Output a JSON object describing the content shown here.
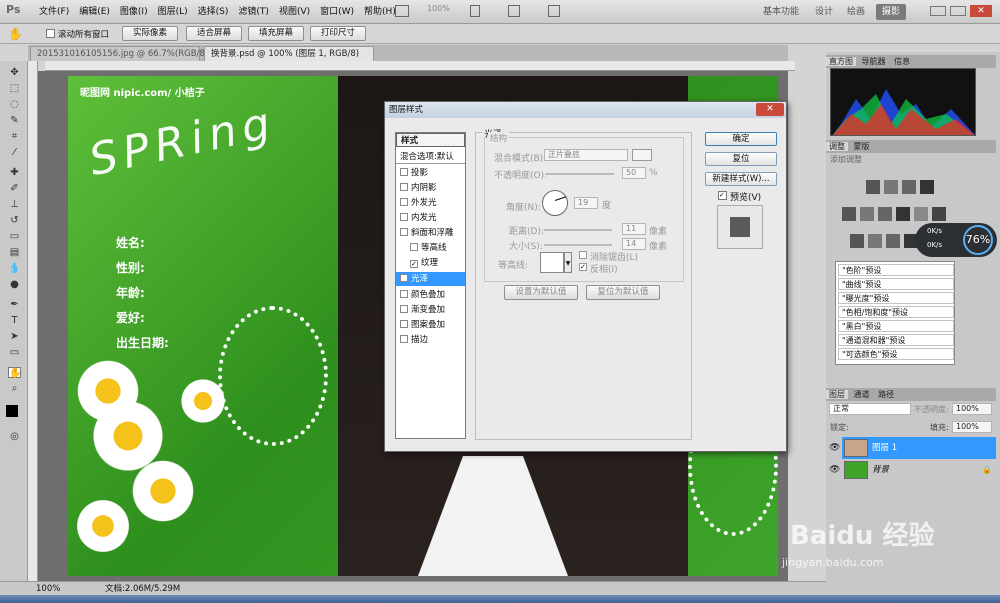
{
  "menubar": {
    "logo": "Ps",
    "items": [
      "文件(F)",
      "编辑(E)",
      "图像(I)",
      "图层(L)",
      "选择(S)",
      "滤镜(T)",
      "视图(V)",
      "窗口(W)",
      "帮助(H)"
    ],
    "zoom": "100%",
    "workspaces": [
      "基本功能",
      "设计",
      "绘画",
      "摄影"
    ],
    "active_workspace": "摄影"
  },
  "options": {
    "scroll_all": "滚动所有窗口",
    "buttons": [
      "实际像素",
      "适合屏幕",
      "填充屏幕",
      "打印尺寸"
    ]
  },
  "tabs": [
    {
      "label": "20153101610515​6.jpg @ 66.7%(RGB/8)"
    },
    {
      "label": "换背景.psd @ 100% (图层 1, RGB/8)"
    }
  ],
  "image": {
    "site": "昵图网 nipic.com/ 小桔子",
    "spring": "SPRing",
    "labels": [
      "姓名:",
      "性别:",
      "年龄:",
      "爱好:",
      "出生日期:"
    ]
  },
  "dialog": {
    "title": "图层样式",
    "styles_header": "样式",
    "blend_default": "混合选项:默认",
    "effects": [
      {
        "label": "投影",
        "checked": false
      },
      {
        "label": "内阴影",
        "checked": false
      },
      {
        "label": "外发光",
        "checked": false
      },
      {
        "label": "内发光",
        "checked": false
      },
      {
        "label": "斜面和浮雕",
        "checked": false
      },
      {
        "label": "等高线",
        "checked": false,
        "indent": true
      },
      {
        "label": "纹理",
        "checked": true,
        "indent": true
      },
      {
        "label": "光泽",
        "checked": false,
        "selected": true
      },
      {
        "label": "颜色叠加",
        "checked": false
      },
      {
        "label": "渐变叠加",
        "checked": false
      },
      {
        "label": "图案叠加",
        "checked": false
      },
      {
        "label": "描边",
        "checked": false
      }
    ],
    "section": "光泽",
    "structure": "结构",
    "blend_mode_label": "混合模式(B):",
    "blend_mode_value": "正片叠底",
    "opacity_label": "不透明度(O):",
    "opacity_value": "50",
    "opacity_unit": "%",
    "angle_label": "角度(N):",
    "angle_value": "19",
    "angle_unit": "度",
    "distance_label": "距离(D):",
    "distance_value": "11",
    "distance_unit": "像素",
    "size_label": "大小(S):",
    "size_value": "14",
    "size_unit": "像素",
    "contour_label": "等高线:",
    "antialias": "消除锯齿(L)",
    "invert": "反相(I)",
    "btn_default": "设置为默认值",
    "btn_reset_default": "复位为默认值",
    "ok": "确定",
    "reset": "复位",
    "new_style": "新建样式(W)...",
    "preview": "预览(V)"
  },
  "right": {
    "hist_tabs": [
      "直方图",
      "导航器",
      "信息"
    ],
    "adj_tabs": [
      "调整",
      "蒙版"
    ],
    "add_adjust": "添加调整",
    "presets": [
      "\"色阶\"预设",
      "\"曲线\"预设",
      "\"曝光度\"预设",
      "\"色相/饱和度\"预设",
      "\"黑白\"预设",
      "\"通道混和器\"预设",
      "\"可选颜色\"预设"
    ],
    "layer_tabs": [
      "图层",
      "通道",
      "路径"
    ],
    "blend": "正常",
    "opacity_label": "不透明度:",
    "opacity": "100%",
    "lock_label": "锁定:",
    "fill_label": "填充:",
    "fill": "100%",
    "layers": [
      {
        "name": "图层 1",
        "selected": true
      },
      {
        "name": "背景",
        "selected": false
      }
    ]
  },
  "speed": {
    "up": "0K/s",
    "down": "0K/s",
    "pct": "76%"
  },
  "status": {
    "zoom": "100%",
    "doc": "文档:2.06M/5.29M"
  },
  "watermark": {
    "brand": "Baidu 经验",
    "url": "jingyan.baidu.com"
  },
  "colors": {
    "accent": "#3399ff",
    "green": "#3ea42a"
  }
}
